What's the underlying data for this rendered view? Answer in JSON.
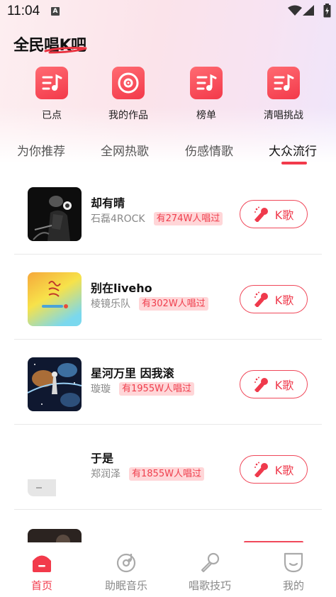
{
  "status_bar": {
    "time": "11:04",
    "notification": "A"
  },
  "brand": {
    "title": "全民唱K吧"
  },
  "quick_menu": [
    {
      "label": "已点",
      "icon": "music-list-icon"
    },
    {
      "label": "我的作品",
      "icon": "disc-icon"
    },
    {
      "label": "榜单",
      "icon": "music-list-icon"
    },
    {
      "label": "清唱挑战",
      "icon": "music-list-icon"
    }
  ],
  "tabs": [
    {
      "label": "为你推荐",
      "active": false
    },
    {
      "label": "全网热歌",
      "active": false
    },
    {
      "label": "伤感情歌",
      "active": false
    },
    {
      "label": "大众流行",
      "active": true
    }
  ],
  "songs": [
    {
      "title": "却有晴",
      "artist": "石磊4ROCK",
      "sung": "有274W人唱过",
      "k_label": "K歌"
    },
    {
      "title": "别在liveho",
      "artist": "棱镜乐队",
      "sung": "有302W人唱过",
      "k_label": "K歌"
    },
    {
      "title": "星河万里 因我滚",
      "artist": "璇璇",
      "sung": "有1955W人唱过",
      "k_label": "K歌"
    },
    {
      "title": "于是",
      "artist": "郑润泽",
      "sung": "有1855W人唱过",
      "k_label": "K歌"
    }
  ],
  "bottom_nav": [
    {
      "label": "首页",
      "icon": "home-icon",
      "active": true
    },
    {
      "label": "助眠音乐",
      "icon": "music-disc-icon",
      "active": false
    },
    {
      "label": "唱歌技巧",
      "icon": "microphone-icon",
      "active": false
    },
    {
      "label": "我的",
      "icon": "profile-icon",
      "active": false
    }
  ],
  "colors": {
    "accent": "#f23a4b",
    "badge_bg": "#ffd6d8"
  }
}
